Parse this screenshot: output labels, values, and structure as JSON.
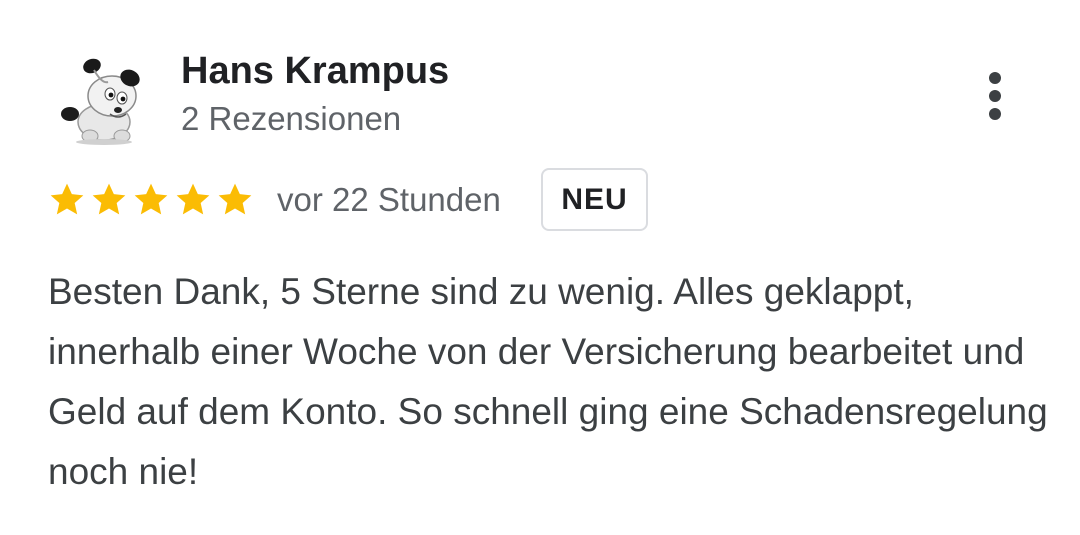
{
  "reviewer": {
    "name": "Hans Krampus",
    "review_count": "2 Rezensionen",
    "avatar_icon": "cartoon-dog-avatar"
  },
  "rating": {
    "stars": 5,
    "max_stars": 5,
    "star_color": "#fbbc04",
    "icon": "star-icon"
  },
  "timestamp": "vor 22 Stunden",
  "badge": "NEU",
  "review_text": "Besten Dank, 5 Sterne sind zu wenig. Alles geklappt, innerhalb einer Woche von der Versicherung bearbeitet und Geld auf dem Konto. So schnell ging eine Schadensregelung noch nie!",
  "menu": {
    "icon": "more-vert-icon"
  },
  "colors": {
    "name": "#202124",
    "secondary": "#5f6368",
    "body_text": "#3c4043",
    "badge_border": "#dadce0"
  }
}
